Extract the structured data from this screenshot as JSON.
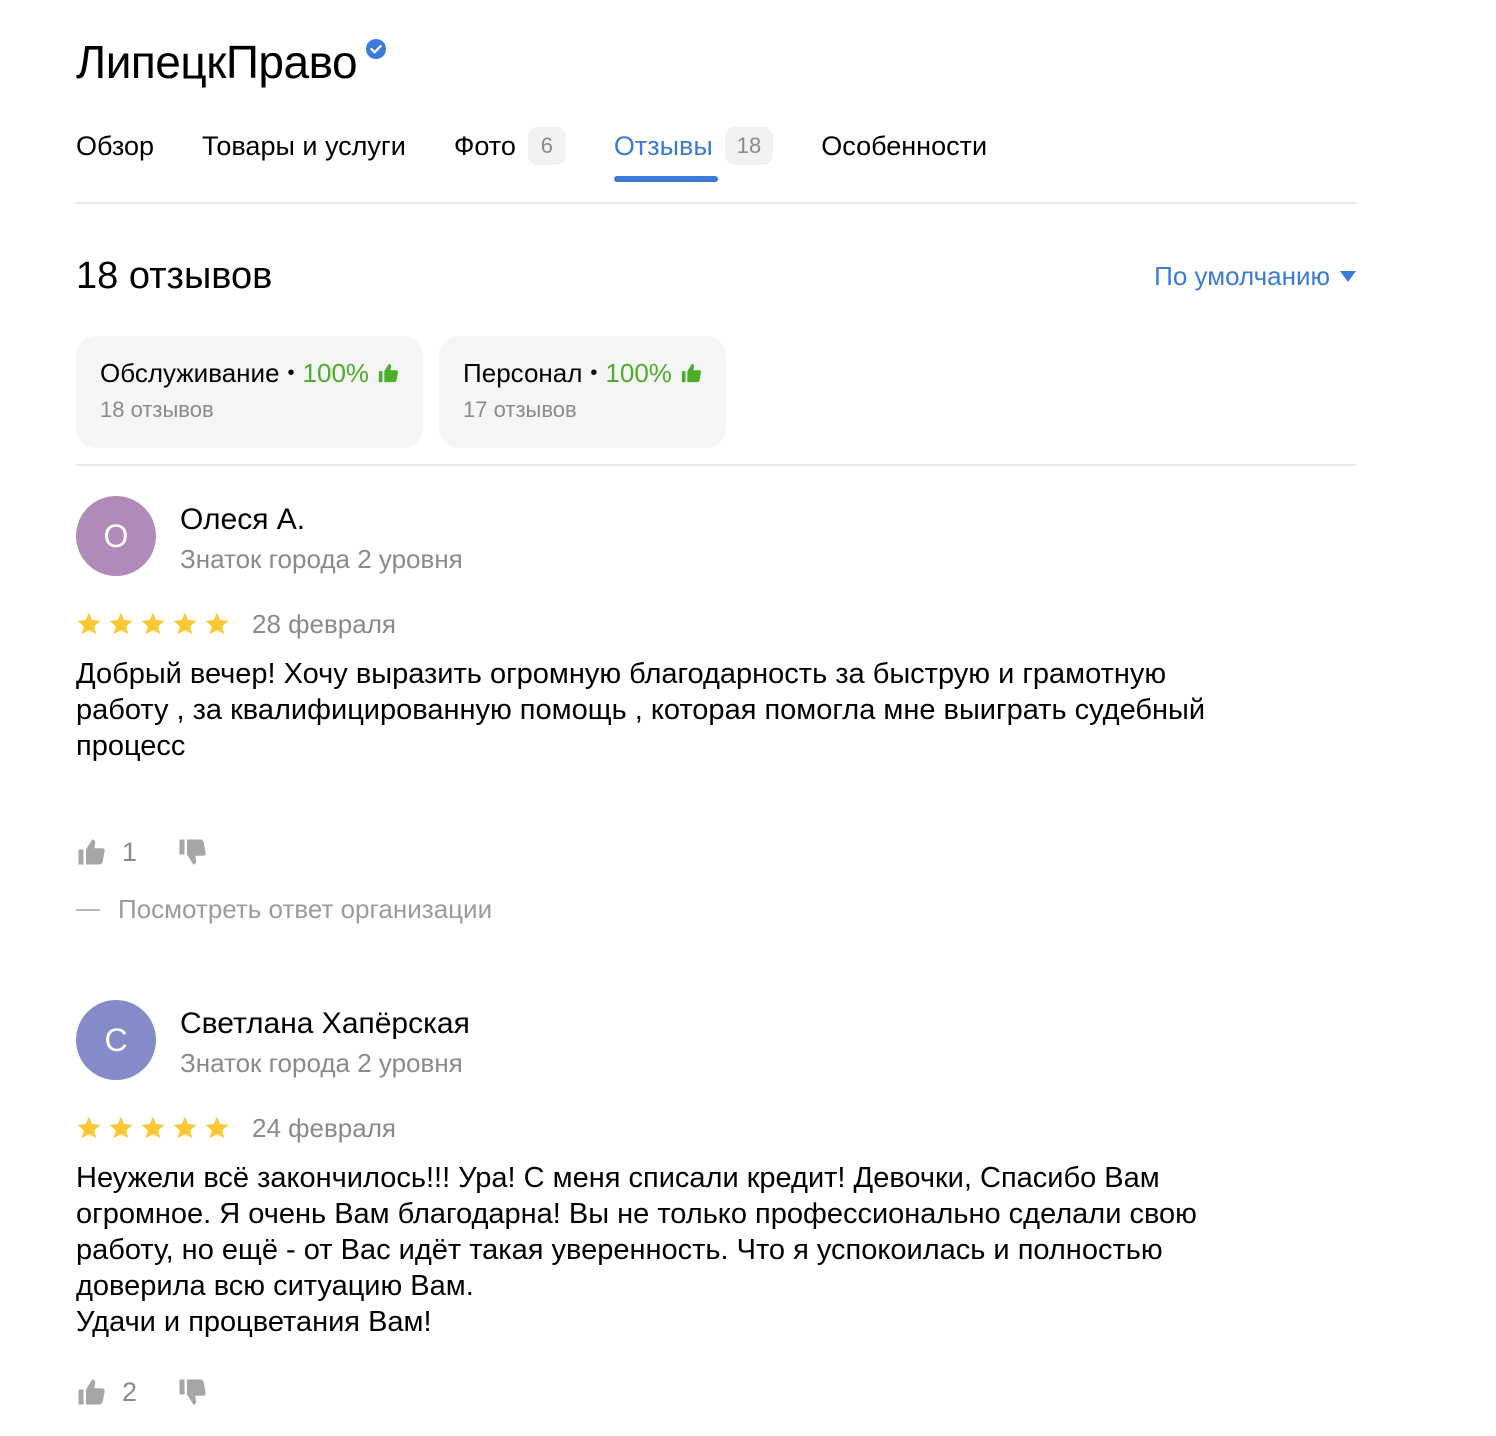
{
  "org": {
    "name": "ЛипецкПраво"
  },
  "tabs": [
    {
      "label": "Обзор"
    },
    {
      "label": "Товары и услуги"
    },
    {
      "label": "Фото",
      "count": "6"
    },
    {
      "label": "Отзывы",
      "count": "18"
    },
    {
      "label": "Особенности"
    }
  ],
  "active_tab": "Отзывы",
  "reviews_header": {
    "count_text": "18 отзывов",
    "sort_label": "По умолчанию"
  },
  "aspects": [
    {
      "name": "Обслуживание",
      "percent": "100%",
      "sub": "18 отзывов"
    },
    {
      "name": "Персонал",
      "percent": "100%",
      "sub": "17 отзывов"
    }
  ],
  "reviews": [
    {
      "initial": "О",
      "avatar_color": "#b08ab8",
      "author": "Олеся А.",
      "level": "Знаток города 2 уровня",
      "rating": 5,
      "date": "28 февраля",
      "text": "Добрый вечер! Хочу выразить огромную благодарность за быструю и грамотную\nработу , за квалифицированную помощь , которая помогла мне выиграть судебный\nпроцесс",
      "likes": "1",
      "org_answer_label": "Посмотреть ответ организации"
    },
    {
      "initial": "С",
      "avatar_color": "#858ac8",
      "author": "Светлана Хапёрская",
      "level": "Знаток города 2 уровня",
      "rating": 5,
      "date": "24 февраля",
      "text": "Неужели всё закончилось!!! Ура! С меня списали кредит! Девочки, Спасибо Вам\nогромное. Я очень Вам благодарна! Вы не только профессионально сделали свою\nработу, но ещё - от Вас идёт такая уверенность. Что я успокоилась и полностью\nдоверила всю ситуацию Вам.\nУдачи и процветания Вам!",
      "likes": "2"
    }
  ],
  "colors": {
    "accent": "#3b7ad9",
    "green": "#4cad2a",
    "star": "#fcc934",
    "muted": "#8a8a8a"
  }
}
